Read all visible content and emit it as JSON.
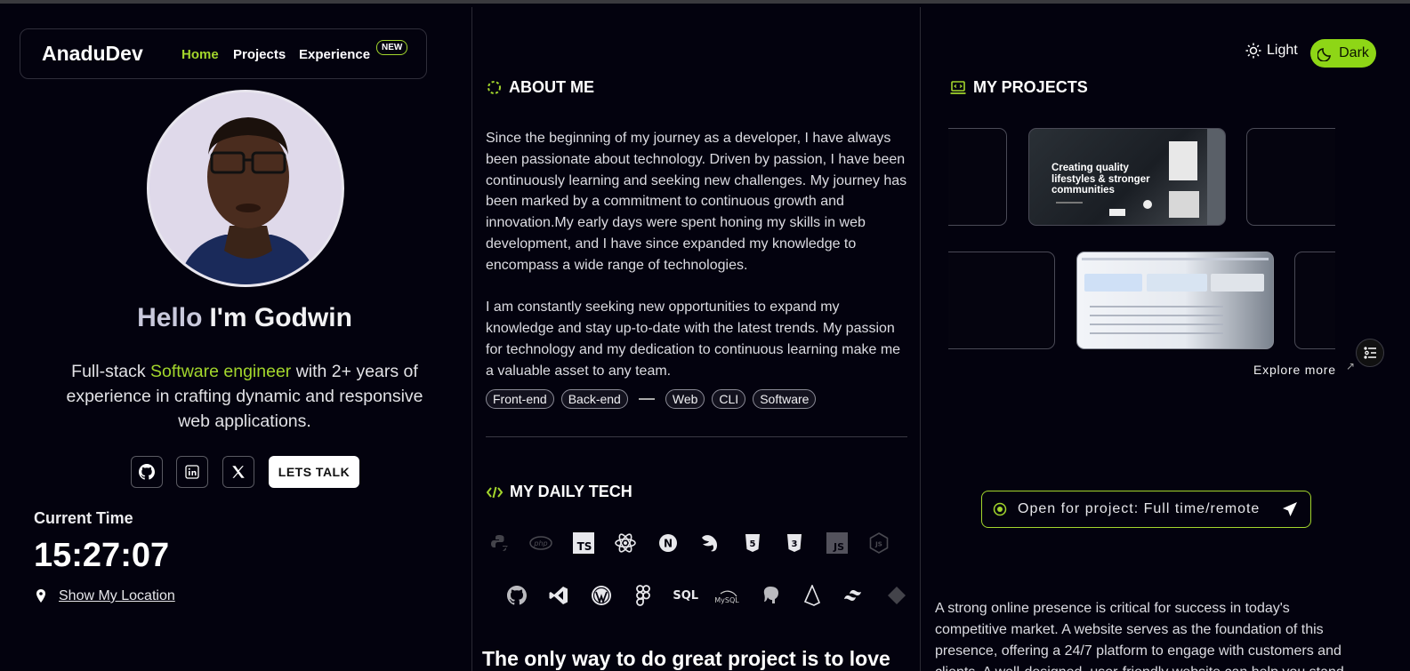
{
  "nav": {
    "brand": "AnaduDev",
    "links": [
      "Home",
      "Projects",
      "Experience"
    ],
    "badge": "NEW"
  },
  "profile": {
    "hello_1": "Hello",
    "hello_2": "I'm Godwin",
    "intro_pre": "Full-stack ",
    "intro_highlight": "Software engineer",
    "intro_post": " with 2+ years of experience in crafting dynamic and responsive web applications.",
    "lets_talk": "LETS TALK",
    "social_icons": [
      "github-icon",
      "linkedin-icon",
      "x-icon"
    ]
  },
  "clock": {
    "label": "Current Time",
    "time": "15:27:07",
    "location_link": "Show My Location"
  },
  "about": {
    "title": "ABOUT ME",
    "paragraph_1": "Since the beginning of my journey as a developer, I have always been passionate about technology. Driven by passion, I have been continuously learning and seeking new challenges. My journey has been marked by a commitment to continuous growth and innovation.My early days were spent honing my skills in web development, and I have since expanded my knowledge to encompass a wide range of technologies.",
    "paragraph_2": "I am constantly seeking new opportunities to expand my knowledge and stay up-to-date with the latest trends. My passion for technology and my dedication to continuous learning make me a valuable asset to any team.",
    "tags_a": [
      "Front-end",
      "Back-end"
    ],
    "tags_b": [
      "Web",
      "CLI",
      "Software"
    ]
  },
  "tech": {
    "title": "MY DAILY TECH",
    "row1_labels": [
      "",
      "php",
      "TS",
      "",
      "N",
      "",
      "5",
      "3",
      "JS",
      "JS"
    ],
    "row2_labels": [
      "",
      "",
      "",
      "",
      "SQL",
      "MySQL",
      "",
      "",
      "",
      ""
    ]
  },
  "quote": "The only way to do great project is to love",
  "theme": {
    "light": "Light",
    "dark": "Dark"
  },
  "projects": {
    "title": "MY PROJECTS",
    "card_headline_1": "Creating quality",
    "card_headline_2": "lifestyles & stronger",
    "card_headline_3": "communities",
    "explore": "Explore more"
  },
  "open_for_project": "Open for project: Full time/remote",
  "col3_text": "A strong online presence is critical for success in today's competitive market. A website serves as the foundation of this presence, offering a 24/7 platform to engage with customers and clients. A well-designed, user-friendly website can help you stand"
}
